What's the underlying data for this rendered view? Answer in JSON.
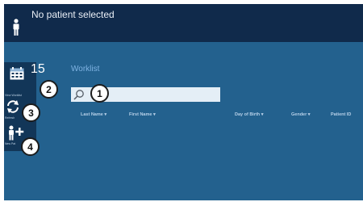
{
  "header": {
    "no_patient_text": "No patient selected"
  },
  "sidebar": {
    "calendar_day": "15",
    "items": [
      {
        "label": "View Worklist"
      },
      {
        "label": "Refresh"
      },
      {
        "label": "New Pat"
      }
    ]
  },
  "main": {
    "title": "Worklist",
    "search": {
      "value": "",
      "placeholder": ""
    },
    "columns": [
      {
        "label": "Last Name ▾"
      },
      {
        "label": "First Name ▾"
      },
      {
        "label": "Day of Birth ▾"
      },
      {
        "label": "Gender ▾"
      },
      {
        "label": "Patient ID"
      }
    ]
  },
  "callouts": [
    "1",
    "2",
    "3",
    "4"
  ],
  "colors": {
    "header_bg": "#102a4b",
    "panel_bg": "#23618e",
    "sidebar_bg": "#123658",
    "accent_text": "#7fb3e3"
  }
}
